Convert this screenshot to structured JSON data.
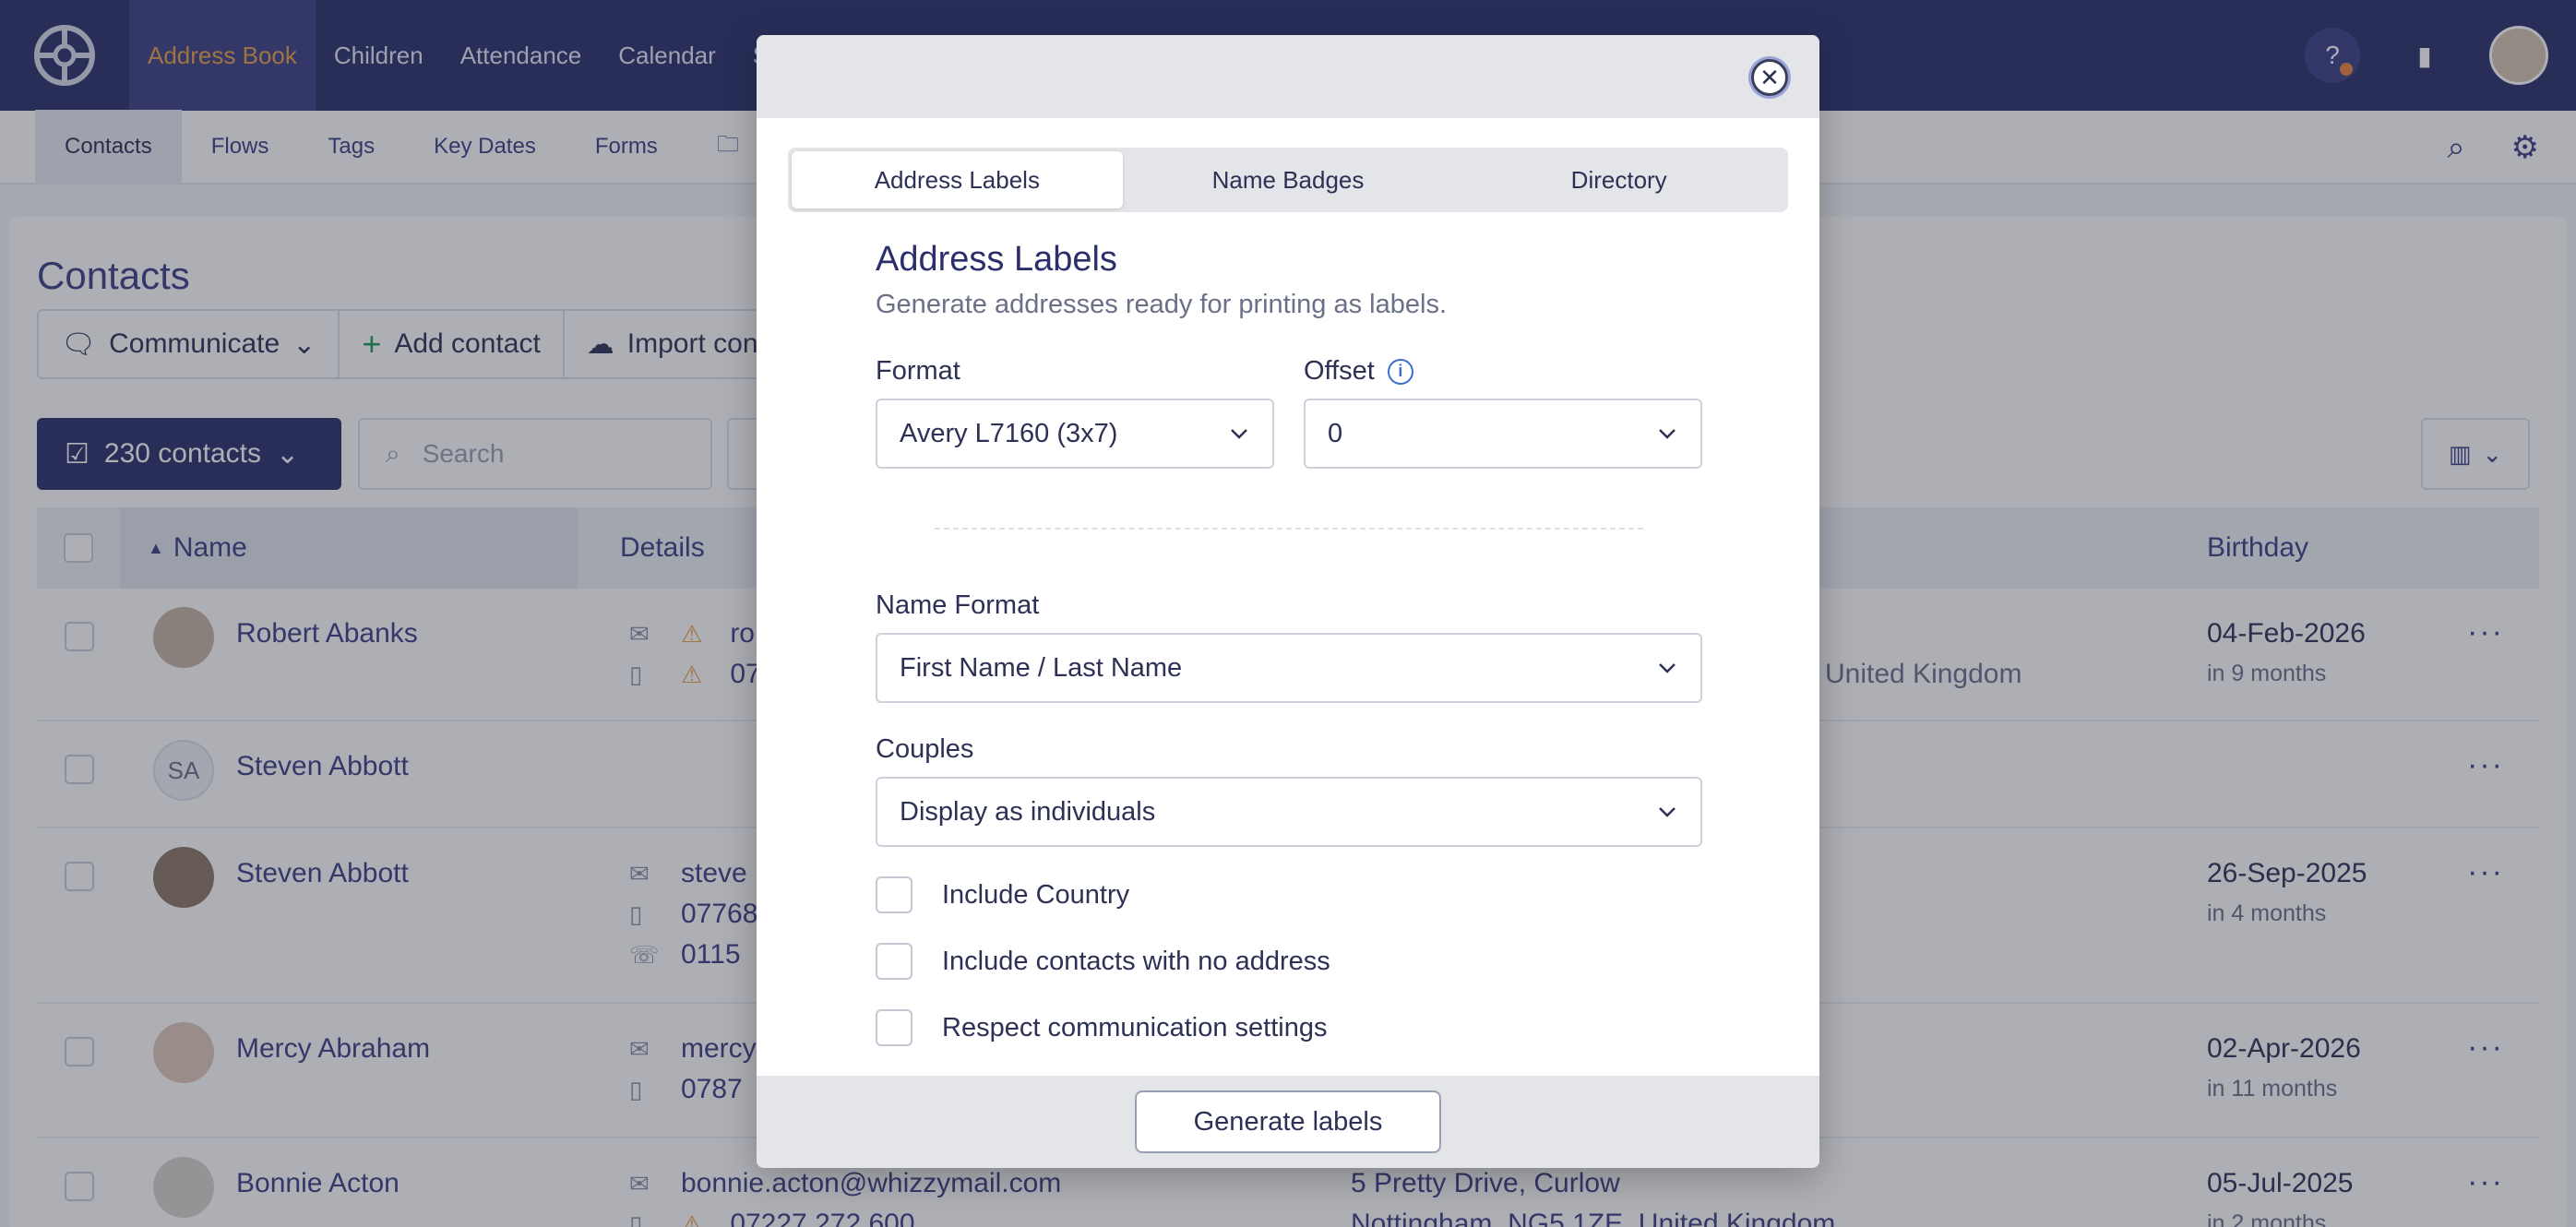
{
  "topnav": {
    "items": [
      "Address Book",
      "Children",
      "Attendance",
      "Calendar",
      "S"
    ],
    "active_index": 0,
    "help_icon": "help-circle-icon",
    "building_icon": "building-icon"
  },
  "subnav": {
    "items": [
      "Contacts",
      "Flows",
      "Tags",
      "Key Dates",
      "Forms"
    ],
    "active_index": 0
  },
  "page": {
    "title": "Contacts",
    "toolbar": {
      "communicate": "Communicate",
      "add_contact": "Add contact",
      "import": "Import con"
    },
    "contacts_count_label": "230 contacts",
    "search_placeholder": "Search"
  },
  "table": {
    "headers": {
      "name": "Name",
      "details": "Details",
      "birthday": "Birthday"
    },
    "rows": [
      {
        "name": "Robert Abanks",
        "details": [
          "ro",
          "07"
        ],
        "address": [
          "United Kingdom"
        ],
        "birthday": "04-Feb-2026",
        "birthday_rel": "in 9 months"
      },
      {
        "name": "Steven Abbott",
        "initials": "SA",
        "details": [],
        "address": [],
        "birthday": "",
        "birthday_rel": ""
      },
      {
        "name": "Steven Abbott",
        "details": [
          "steve",
          "07768",
          "0115"
        ],
        "address": [],
        "birthday": "26-Sep-2025",
        "birthday_rel": "in 4 months"
      },
      {
        "name": "Mercy Abraham",
        "details": [
          "mercy",
          "0787"
        ],
        "address": [],
        "birthday": "02-Apr-2026",
        "birthday_rel": "in 11 months"
      },
      {
        "name": "Bonnie Acton",
        "details": [
          "bonnie.acton@whizzymail.com",
          "07227 272 600"
        ],
        "address": [
          "5 Pretty Drive, Curlow",
          "Nottingham, NG5 1ZE, United Kingdom"
        ],
        "birthday": "05-Jul-2025",
        "birthday_rel": "in 2 months"
      }
    ]
  },
  "modal": {
    "tabs": [
      "Address Labels",
      "Name Badges",
      "Directory"
    ],
    "active_tab": 0,
    "title": "Address Labels",
    "subtitle": "Generate addresses ready for printing as labels.",
    "format_label": "Format",
    "format_value": "Avery L7160 (3x7)",
    "offset_label": "Offset",
    "offset_value": "0",
    "name_format_label": "Name Format",
    "name_format_value": "First Name / Last Name",
    "couples_label": "Couples",
    "couples_value": "Display as individuals",
    "checkboxes": [
      {
        "label": "Include Country",
        "checked": false
      },
      {
        "label": "Include contacts with no address",
        "checked": false
      },
      {
        "label": "Respect communication settings",
        "checked": false
      }
    ],
    "generate_label": "Generate labels"
  },
  "colors": {
    "nav_bg": "#2b2f6b",
    "nav_active_text": "#e8a046",
    "accent": "#3a3f85",
    "overlay": "rgba(40,44,60,0.38)"
  }
}
